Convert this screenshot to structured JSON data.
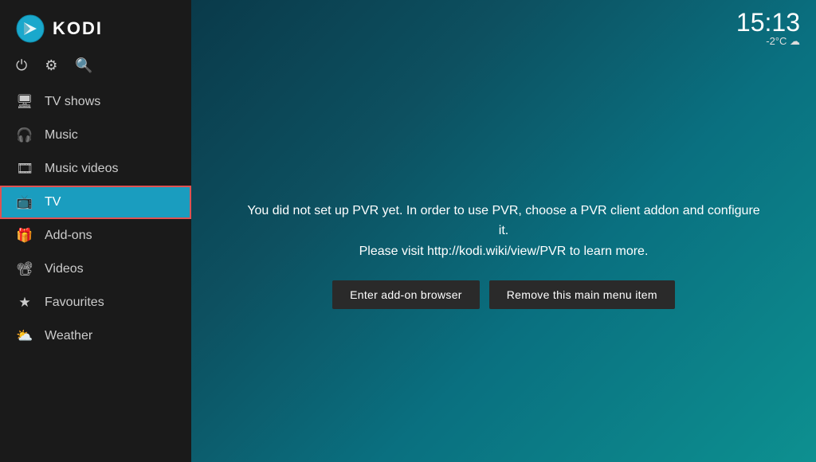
{
  "app": {
    "title": "KODI"
  },
  "clock": {
    "time": "15:13",
    "meta": "-2°C ☁"
  },
  "toolbar": {
    "power_icon": "⏻",
    "settings_icon": "⚙",
    "search_icon": "🔍"
  },
  "nav": {
    "items": [
      {
        "id": "tv-shows",
        "label": "TV shows",
        "icon": "🖥",
        "active": false
      },
      {
        "id": "music",
        "label": "Music",
        "icon": "🎧",
        "active": false
      },
      {
        "id": "music-videos",
        "label": "Music videos",
        "icon": "🎞",
        "active": false
      },
      {
        "id": "tv",
        "label": "TV",
        "icon": "📺",
        "active": true
      },
      {
        "id": "add-ons",
        "label": "Add-ons",
        "icon": "🎁",
        "active": false
      },
      {
        "id": "videos",
        "label": "Videos",
        "icon": "📽",
        "active": false
      },
      {
        "id": "favourites",
        "label": "Favourites",
        "icon": "★",
        "active": false
      },
      {
        "id": "weather",
        "label": "Weather",
        "icon": "⛅",
        "active": false
      }
    ]
  },
  "pvr": {
    "message_line1": "You did not set up PVR yet. In order to use PVR, choose a PVR client addon and configure it.",
    "message_line2": "Please visit http://kodi.wiki/view/PVR to learn more.",
    "button_addon_browser": "Enter add-on browser",
    "button_remove_item": "Remove this main menu item"
  }
}
